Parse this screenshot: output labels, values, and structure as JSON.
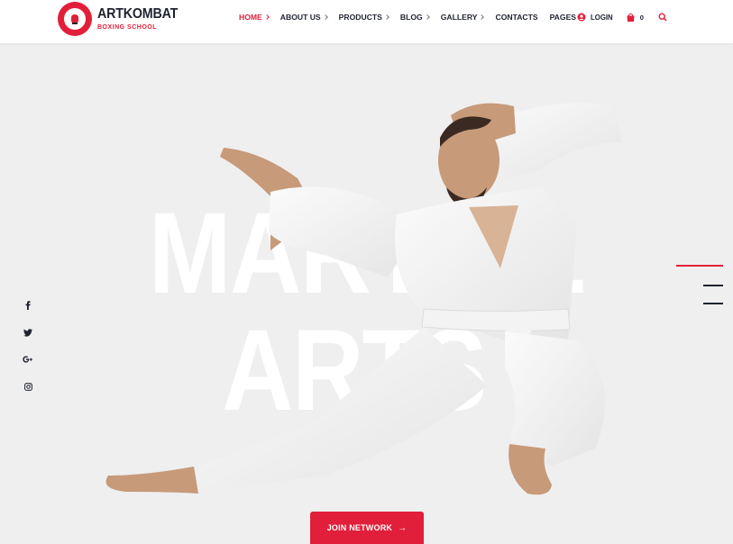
{
  "brand": {
    "name": "ARTKOMBAT",
    "tagline": "BOXING SCHOOL",
    "accent_color": "#e21f3a",
    "text_color": "#1f2330"
  },
  "nav": {
    "items": [
      {
        "label": "HOME",
        "active": true
      },
      {
        "label": "ABOUT US",
        "active": false
      },
      {
        "label": "PRODUCTS",
        "active": false
      },
      {
        "label": "BLOG",
        "active": false
      },
      {
        "label": "GALLERY",
        "active": false
      },
      {
        "label": "CONTACTS",
        "active": false
      },
      {
        "label": "PAGES",
        "active": false
      }
    ]
  },
  "header_actions": {
    "login_label": "LOGIN",
    "cart_count": "0",
    "icons": [
      "user-icon",
      "shopping-bag-icon",
      "search-icon"
    ]
  },
  "hero": {
    "line1": "MARTIAL",
    "line2": "ARTS",
    "cta_label": "JOIN NETWORK",
    "cta_arrow": "→"
  },
  "social": [
    {
      "name": "facebook-icon",
      "glyph": "f"
    },
    {
      "name": "twitter-icon",
      "glyph": "t"
    },
    {
      "name": "google-plus-icon",
      "glyph": "G+"
    },
    {
      "name": "instagram-icon",
      "glyph": "ig"
    }
  ],
  "slider": {
    "active_slide": 1,
    "slide_count": 3
  }
}
